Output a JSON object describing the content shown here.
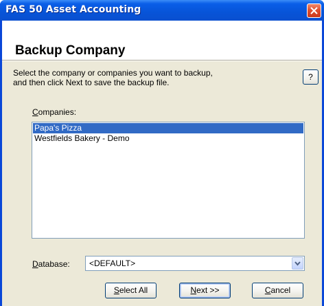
{
  "window": {
    "title": "FAS 50 Asset Accounting"
  },
  "header": {
    "title": "Backup Company"
  },
  "instructions": {
    "line1": "Select the company or companies you want to backup,",
    "line2": "and then click Next to save the backup file."
  },
  "help_button": {
    "label": "?"
  },
  "companies": {
    "label_mnemonic": "C",
    "label_rest": "ompanies:",
    "items": [
      {
        "label": "Papa's Pizza",
        "selected": true
      },
      {
        "label": "Westfields Bakery - Demo",
        "selected": false
      }
    ]
  },
  "database": {
    "label_mnemonic": "D",
    "label_rest": "atabase:",
    "value": "<DEFAULT>"
  },
  "buttons": {
    "select_all_mnemonic": "S",
    "select_all_rest": "elect All",
    "next_mnemonic": "N",
    "next_rest": "ext >>",
    "cancel_mnemonic": "C",
    "cancel_rest": "ancel"
  },
  "icons": {
    "close": "close-icon",
    "dropdown": "chevron-down-icon"
  },
  "colors": {
    "titlebar": "#0a5ee8",
    "close_button": "#e0502f",
    "selection": "#316ac5",
    "dialog_face": "#ece9d8"
  }
}
